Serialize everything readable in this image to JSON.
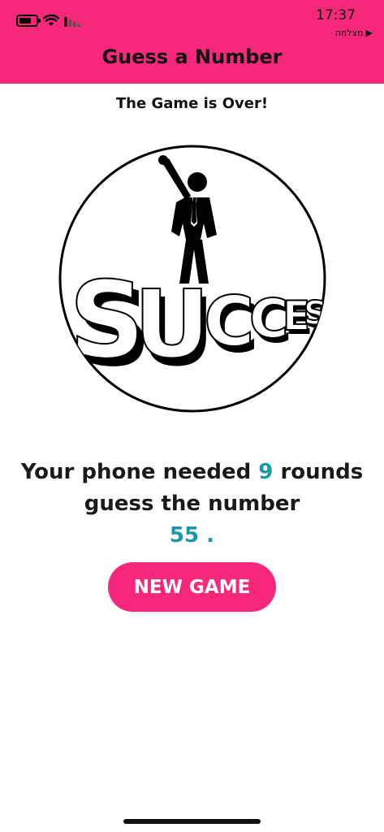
{
  "status_bar": {
    "time": "17:37",
    "back_label": "מצלמה",
    "back_arrow": "▶",
    "icons": [
      "battery-icon",
      "wifi-icon",
      "cellular-signal-icon"
    ]
  },
  "app_bar": {
    "title": "Guess a Number",
    "color": "#f7287b"
  },
  "main": {
    "heading": "The Game is Over!",
    "image": {
      "name": "success-illustration",
      "word": "SUCCESS"
    },
    "result": {
      "prefix": "Your phone needed",
      "rounds": "9",
      "middle": "rounds guess the number",
      "number": "55",
      "suffix": "."
    },
    "new_game_label": "NEW GAME"
  },
  "colors": {
    "accent": "#f7287b",
    "number_highlight": "#1b95aa",
    "text": "#1a1a1a"
  }
}
